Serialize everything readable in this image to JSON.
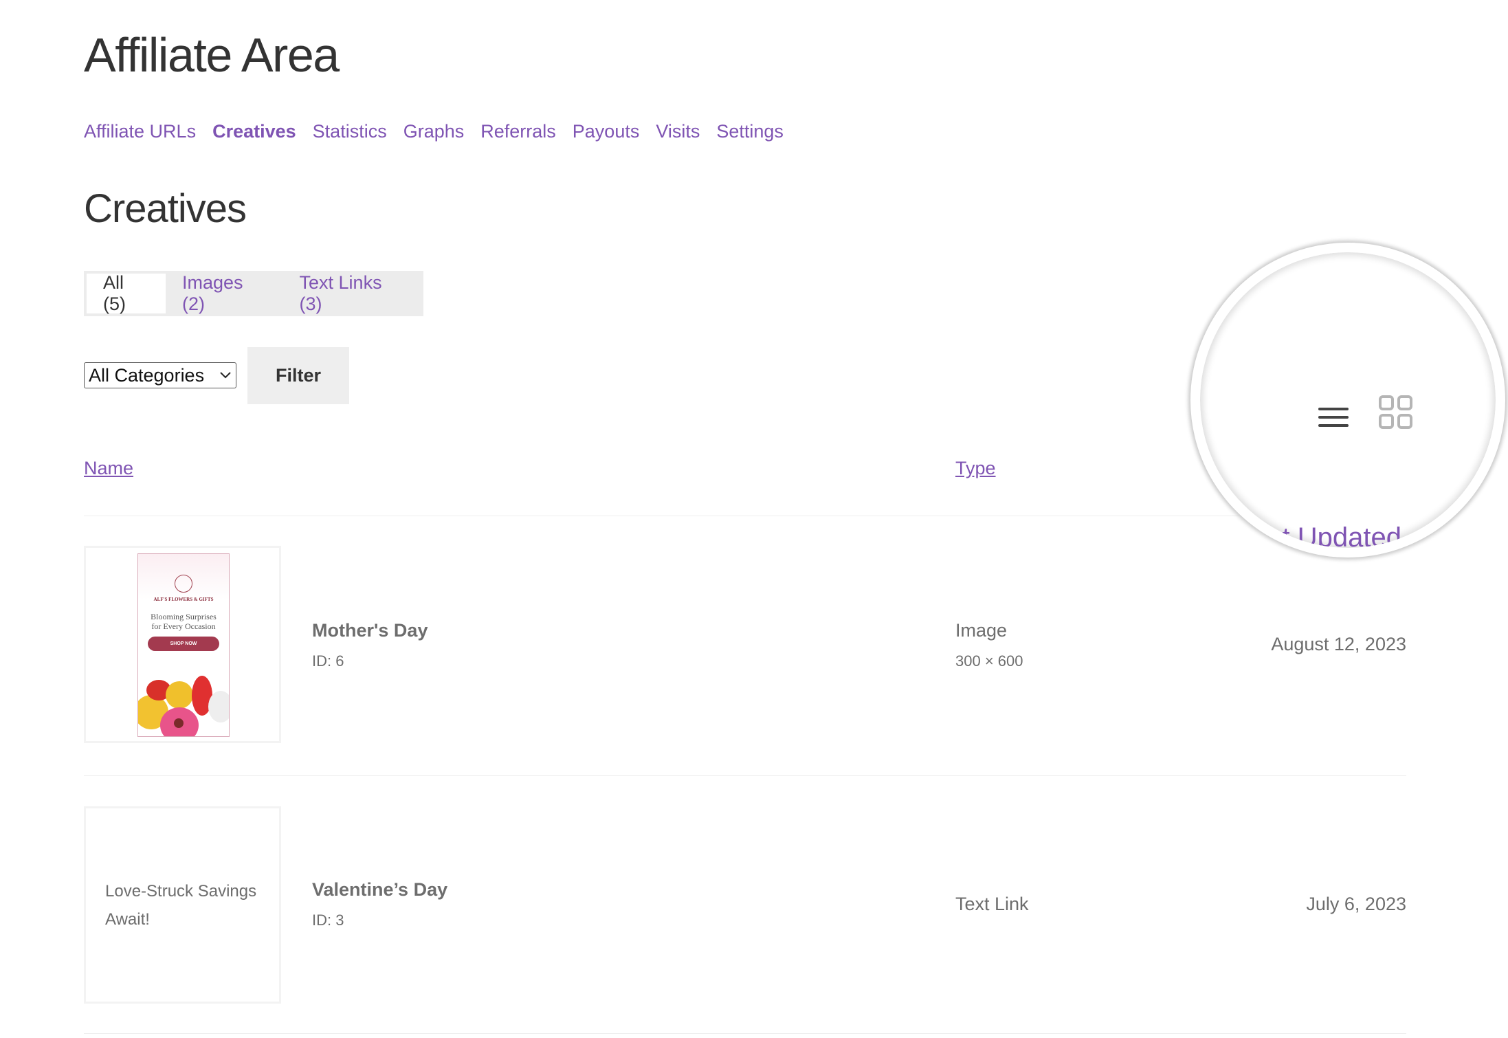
{
  "page": {
    "title": "Affiliate Area",
    "section_title": "Creatives"
  },
  "nav": [
    {
      "label": "Affiliate URLs"
    },
    {
      "label": "Creatives",
      "active": true
    },
    {
      "label": "Statistics"
    },
    {
      "label": "Graphs"
    },
    {
      "label": "Referrals"
    },
    {
      "label": "Payouts"
    },
    {
      "label": "Visits"
    },
    {
      "label": "Settings"
    }
  ],
  "tabs": [
    {
      "label": "All (5)",
      "active": true
    },
    {
      "label": "Images (2)"
    },
    {
      "label": "Text Links (3)"
    }
  ],
  "filter": {
    "category_selected": "All Categories",
    "button_label": "Filter"
  },
  "table": {
    "headers": {
      "name": "Name",
      "type": "Type",
      "last_updated": "Last Updated"
    },
    "rows": [
      {
        "name": "Mother's Day",
        "id": "ID: 6",
        "type": "Image",
        "size": "300 × 600",
        "date": "August 12, 2023",
        "banner": {
          "brand": "ALF'S FLOWERS & GIFTS",
          "headline": "Blooming Surprises for Every Occasion",
          "cta": "SHOP NOW"
        }
      },
      {
        "name": "Valentine’s Day",
        "id": "ID: 3",
        "type": "Text Link",
        "date": "July 6, 2023",
        "preview_text": "Love-Struck Savings Await!"
      }
    ]
  },
  "view_toggle": {
    "list_icon": "list-view-icon",
    "grid_icon": "grid-view-icon",
    "active": "list"
  },
  "colors": {
    "accent": "#7f54b3",
    "text": "#6d6d6d"
  }
}
